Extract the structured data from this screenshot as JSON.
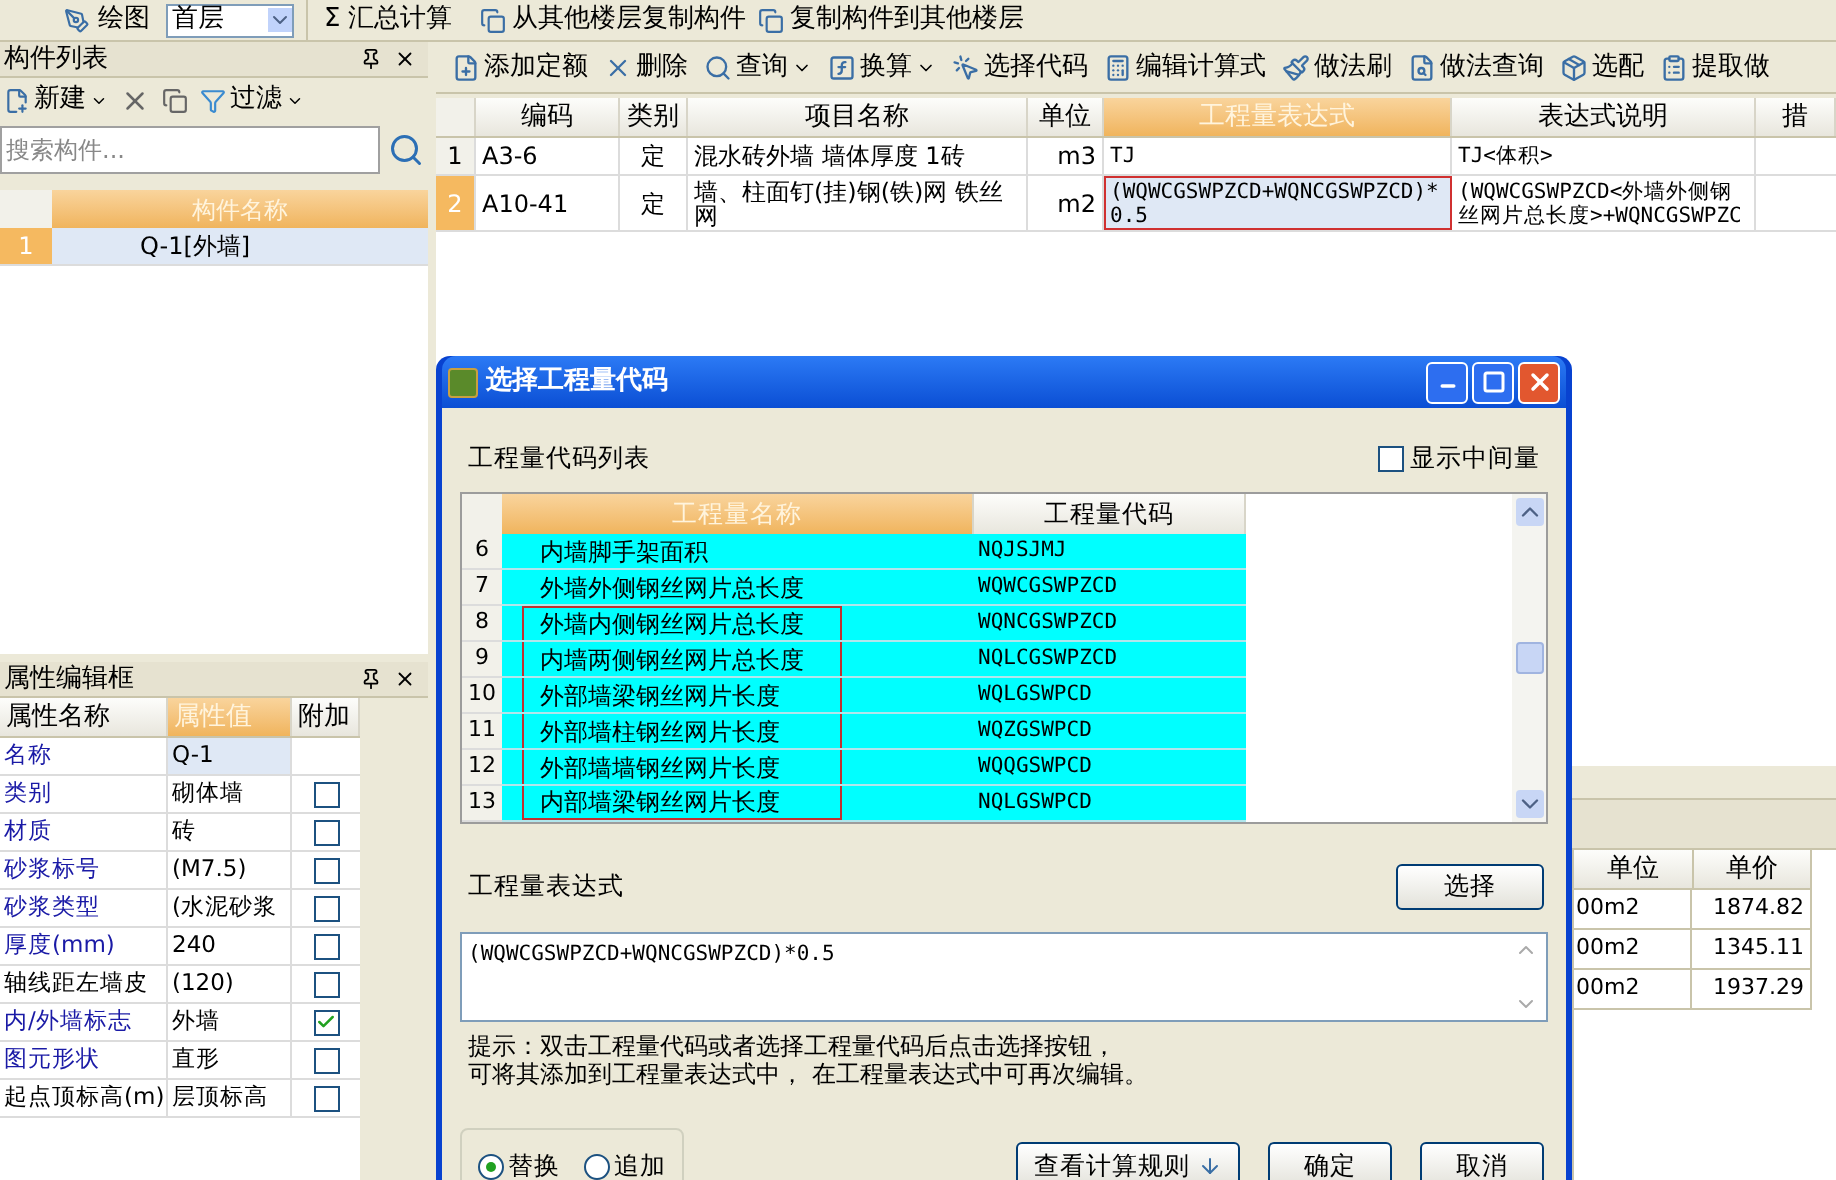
{
  "top_toolbar": {
    "draw_button": "绘图",
    "floor_select": "首层",
    "sum_icon": "Σ",
    "sum_button": "汇总计算",
    "copy_from_button": "从其他楼层复制构件",
    "copy_to_button": "复制构件到其他楼层"
  },
  "component_panel": {
    "title": "构件列表",
    "new_button": "新建",
    "filter_button": "过滤",
    "search": {
      "placeholder": "搜索构件..."
    },
    "column": "构件名称",
    "rows": [
      {
        "number": "1",
        "name": "Q-1[外墙]",
        "selected": true
      }
    ]
  },
  "property_panel": {
    "title": "属性编辑框",
    "columns": [
      {
        "label": "属性名称",
        "selected": false
      },
      {
        "label": "属性值",
        "selected": true
      },
      {
        "label": "附加",
        "selected": false
      }
    ],
    "rows": [
      {
        "name": "名称",
        "value": "Q-1",
        "public": true,
        "kind": "plain",
        "selected": true
      },
      {
        "name": "类别",
        "value": "砌体墙",
        "public": true,
        "kind": "check",
        "checked": false,
        "selected": false
      },
      {
        "name": "材质",
        "value": "砖",
        "public": true,
        "kind": "check",
        "checked": false,
        "selected": false
      },
      {
        "name": "砂浆标号",
        "value": "(M7.5)",
        "public": true,
        "kind": "check",
        "checked": false,
        "selected": false
      },
      {
        "name": "砂浆类型",
        "value": "(水泥砂浆",
        "public": true,
        "kind": "check",
        "checked": false,
        "selected": false
      },
      {
        "name": "厚度(mm)",
        "value": "240",
        "public": true,
        "kind": "check",
        "checked": false,
        "selected": false
      },
      {
        "name": "轴线距左墙皮",
        "value": "(120)",
        "public": false,
        "kind": "check",
        "checked": false,
        "selected": false
      },
      {
        "name": "内/外墙标志",
        "value": "外墙",
        "public": true,
        "kind": "check",
        "checked": true,
        "selected": false
      },
      {
        "name": "图元形状",
        "value": "直形",
        "public": true,
        "kind": "check",
        "checked": false,
        "selected": false
      },
      {
        "name": "起点顶标高(m)",
        "value": "层顶标高",
        "public": false,
        "kind": "check",
        "checked": false,
        "selected": false
      }
    ]
  },
  "quota_toolbar": [
    {
      "label": "添加定额",
      "dropdown": false
    },
    {
      "label": "删除",
      "dropdown": false
    },
    {
      "label": "查询",
      "dropdown": true
    },
    {
      "label": "换算",
      "dropdown": true
    },
    {
      "label": "选择代码",
      "dropdown": false
    },
    {
      "label": "编辑计算式",
      "dropdown": false
    },
    {
      "label": "做法刷",
      "dropdown": false
    },
    {
      "label": "做法查询",
      "dropdown": false
    },
    {
      "label": "选配",
      "dropdown": false
    },
    {
      "label": "提取做",
      "dropdown": false
    }
  ],
  "quota_table": {
    "columns": [
      {
        "label": "编码",
        "selected": false
      },
      {
        "label": "类别",
        "selected": false
      },
      {
        "label": "项目名称",
        "selected": false
      },
      {
        "label": "单位",
        "selected": false
      },
      {
        "label": "工程量表达式",
        "selected": true
      },
      {
        "label": "表达式说明",
        "selected": false
      },
      {
        "label": "措",
        "selected": false
      }
    ],
    "rows": [
      {
        "number": "1",
        "code": "A3-6",
        "type": "定",
        "name": "混水砖外墙 墙体厚度 1砖",
        "unit": "m3",
        "expression": "TJ",
        "description": "TJ<体积>",
        "selected": false,
        "annotated": false
      },
      {
        "number": "2",
        "code": "A10-41",
        "type": "定",
        "name": "墙、柱面钉(挂)钢(铁)网 铁丝网",
        "unit": "m2",
        "expression": "(WQWCGSWPZCD+WQNCGSWPZCD)*0.5",
        "description": "(WQWCGSWPZCD<外墙外侧钢丝网片总长度>+WQNCGSWPZC",
        "selected": true,
        "annotated": true
      }
    ]
  },
  "price_table": {
    "columns": [
      "单位",
      "单价"
    ],
    "rows": [
      {
        "unit": "00m2",
        "price": "1874.82"
      },
      {
        "unit": "00m2",
        "price": "1345.11"
      },
      {
        "unit": "00m2",
        "price": "1937.29"
      }
    ]
  },
  "dialog": {
    "title": "选择工程量代码",
    "list_label": "工程量代码列表",
    "show_intermediate": {
      "label": "显示中间量",
      "checked": false
    },
    "columns": [
      {
        "label": "工程量名称",
        "selected": true
      },
      {
        "label": "工程量代码",
        "selected": false
      }
    ],
    "rows": [
      {
        "number": "6",
        "name": "内墙脚手架面积",
        "code": "NQJSJMJ",
        "annotated": false
      },
      {
        "number": "7",
        "name": "外墙外侧钢丝网片总长度",
        "code": "WQWCGSWPZCD",
        "annotated": false
      },
      {
        "number": "8",
        "name": "外墙内侧钢丝网片总长度",
        "code": "WQNCGSWPZCD",
        "annotated": true
      },
      {
        "number": "9",
        "name": "内墙两侧钢丝网片总长度",
        "code": "NQLCGSWPZCD",
        "annotated": true
      },
      {
        "number": "10",
        "name": "外部墙梁钢丝网片长度",
        "code": "WQLGSWPCD",
        "annotated": true
      },
      {
        "number": "11",
        "name": "外部墙柱钢丝网片长度",
        "code": "WQZGSWPCD",
        "annotated": true
      },
      {
        "number": "12",
        "name": "外部墙墙钢丝网片长度",
        "code": "WQQGSWPCD",
        "annotated": true
      },
      {
        "number": "13",
        "name": "内部墙梁钢丝网片长度",
        "code": "NQLGSWPCD",
        "annotated": true
      }
    ],
    "expression_label": "工程量表达式",
    "select_button": "选择",
    "expression": "(WQWCGSWPZCD+WQNCGSWPZCD)*0.5",
    "hint_lines": [
      "提示：双击工程量代码或者选择工程量代码后点击选择按钮，",
      "可将其添加到工程量表达式中， 在工程量表达式中可再次编辑。"
    ],
    "modes": [
      {
        "label": "替换",
        "selected": true
      },
      {
        "label": "追加",
        "selected": false
      }
    ],
    "buttons": [
      "查看计算规则",
      "确定",
      "取消"
    ]
  }
}
